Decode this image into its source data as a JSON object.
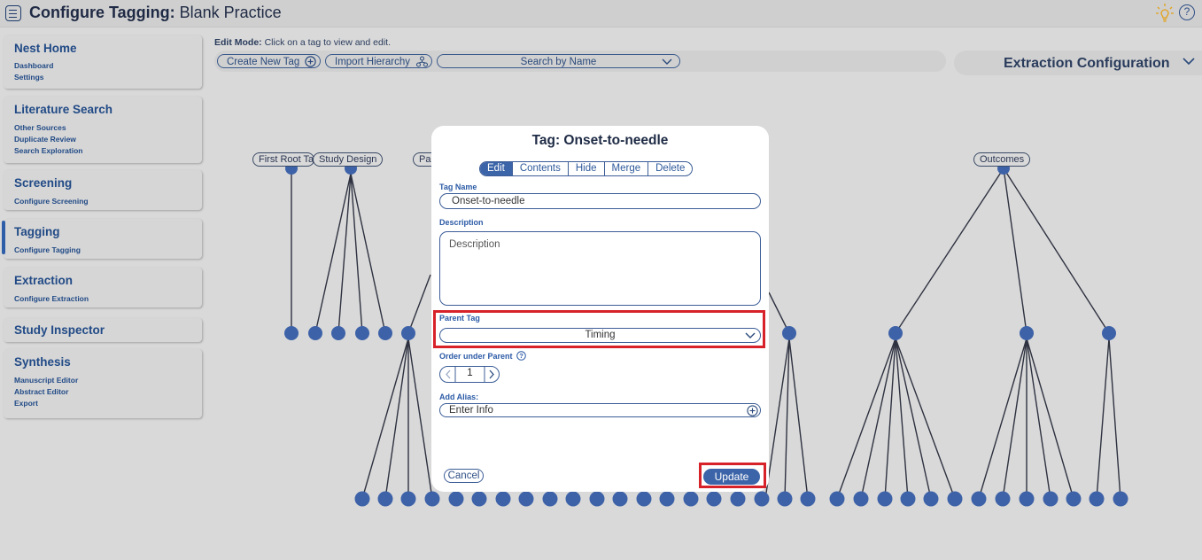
{
  "topbar": {
    "title_bold": "Configure Tagging:",
    "title_rest": " Blank Practice",
    "help_glyph": "?"
  },
  "sidebar": {
    "sections": [
      {
        "title": "Nest Home",
        "items": [
          "Dashboard",
          "Settings"
        ]
      },
      {
        "title": "Literature Search",
        "items": [
          "Other Sources",
          "Duplicate Review",
          "Search Exploration"
        ]
      },
      {
        "title": "Screening",
        "items": [
          "Configure Screening"
        ]
      },
      {
        "title": "Tagging",
        "items": [
          "Configure Tagging"
        ]
      },
      {
        "title": "Extraction",
        "items": [
          "Configure Extraction"
        ]
      },
      {
        "title": "Study Inspector",
        "items": []
      },
      {
        "title": "Synthesis",
        "items": [
          "Manuscript Editor",
          "Abstract Editor",
          "Export"
        ]
      }
    ],
    "active_section": "Tagging"
  },
  "edit_mode": {
    "label": "Edit Mode:",
    "text": " Click on a tag to view and edit."
  },
  "toolbar": {
    "create_label": "Create New Tag",
    "import_label": "Import Hierarchy",
    "search_placeholder": "Search by Name"
  },
  "extraction_panel": {
    "label": "Extraction Configuration"
  },
  "tree": {
    "root_labels": [
      "First Root Ta",
      "Study Design",
      "Pa",
      "Outcomes"
    ]
  },
  "modal": {
    "title": "Tag: Onset-to-needle",
    "tabs": [
      "Edit",
      "Contents",
      "Hide",
      "Merge",
      "Delete"
    ],
    "active_tab": "Edit",
    "tag_name_label": "Tag Name",
    "tag_name_value": "Onset-to-needle",
    "description_label": "Description",
    "description_placeholder": "Description",
    "parent_label": "Parent Tag",
    "parent_value": "Timing",
    "order_label": "Order under Parent",
    "order_value": "1",
    "alias_label": "Add Alias:",
    "alias_placeholder": "Enter Info",
    "cancel_label": "Cancel",
    "update_label": "Update"
  },
  "colors": {
    "accent": "#3c64a8",
    "highlight": "#d8222a",
    "node": "#3d62a8",
    "background": "#d9d9d9"
  }
}
